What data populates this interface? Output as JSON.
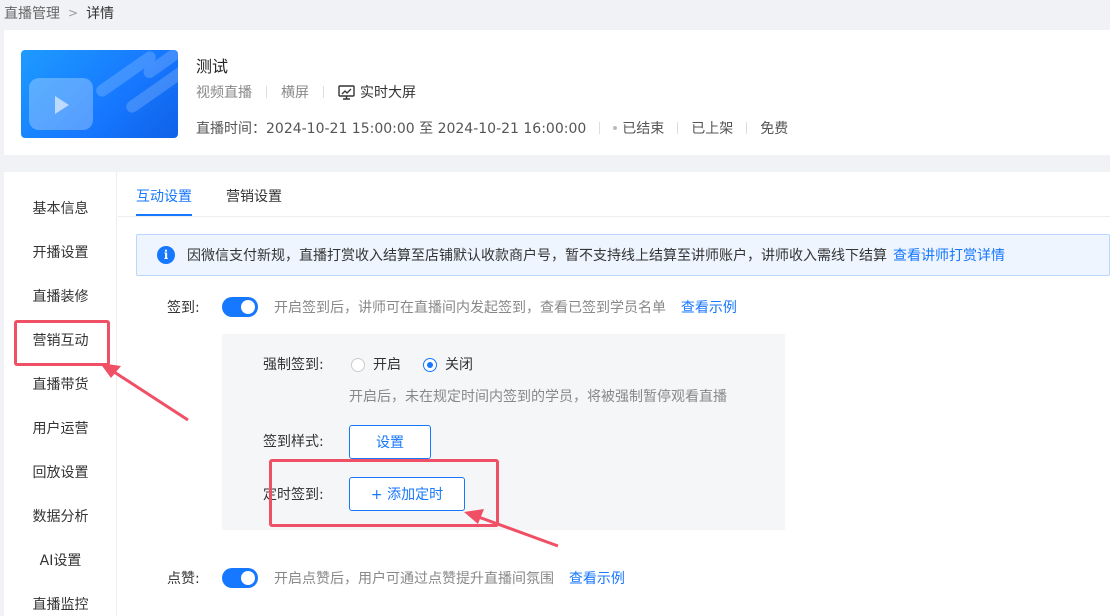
{
  "breadcrumb": {
    "parent": "直播管理",
    "separator": ">",
    "current": "详情"
  },
  "live": {
    "title": "测试",
    "type": "视频直播",
    "orientation": "横屏",
    "screen_mode": "实时大屏",
    "time_label": "直播时间：",
    "time_range": "2024-10-21 15:00:00 至 2024-10-21 16:00:00",
    "status": "已结束",
    "shelf": "已上架",
    "price": "免费"
  },
  "sidenav": {
    "items": [
      {
        "label": "基本信息"
      },
      {
        "label": "开播设置"
      },
      {
        "label": "直播装修"
      },
      {
        "label": "营销互动",
        "active": true
      },
      {
        "label": "直播带货"
      },
      {
        "label": "用户运营"
      },
      {
        "label": "回放设置"
      },
      {
        "label": "数据分析"
      },
      {
        "label": "AI设置"
      },
      {
        "label": "直播监控"
      }
    ]
  },
  "tabs": [
    {
      "label": "互动设置",
      "active": true
    },
    {
      "label": "营销设置"
    }
  ],
  "notice": {
    "text": "因微信支付新规，直播打赏收入结算至店铺默认收款商户号，暂不支持线上结算至讲师账户，讲师收入需线下结算",
    "link": "查看讲师打赏详情"
  },
  "checkin": {
    "label": "签到:",
    "enabled": true,
    "hint": "开启签到后，讲师可在直播间内发起签到，查看已签到学员名单",
    "example_link": "查看示例",
    "force": {
      "label": "强制签到:",
      "options": [
        "开启",
        "关闭"
      ],
      "selected": "关闭",
      "hint": "开启后，未在规定时间内签到的学员，将被强制暂停观看直播"
    },
    "style": {
      "label": "签到样式:",
      "button": "设置"
    },
    "timer": {
      "label": "定时签到:",
      "button": "+ 添加定时"
    }
  },
  "like": {
    "label": "点赞:",
    "enabled": true,
    "hint": "开启点赞后，用户可通过点赞提升直播间氛围",
    "example_link": "查看示例"
  },
  "colors": {
    "accent": "#1677ff",
    "annotation": "#f05065"
  }
}
